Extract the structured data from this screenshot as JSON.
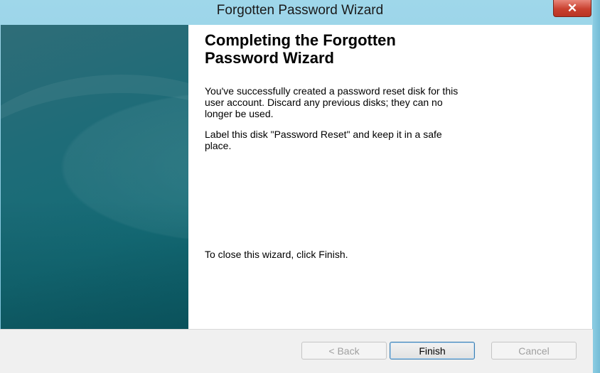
{
  "window": {
    "title": "Forgotten Password Wizard",
    "close_label": "✕"
  },
  "wizard": {
    "heading_line1": "Completing the Forgotten",
    "heading_line2": "Password Wizard",
    "para1_line1": "You've successfully created a password reset disk for this",
    "para1_line2": "user account. Discard any previous disks; they can no",
    "para1_line3": "longer be used.",
    "para2_line1": "Label this disk \"Password Reset\" and keep it in a safe",
    "para2_line2": "place.",
    "para3": "To close this wizard, click Finish."
  },
  "buttons": {
    "back": "< Back",
    "finish": "Finish",
    "cancel": "Cancel"
  },
  "colors": {
    "title_bar": "#9fd7ea",
    "side_panel": "#146b76",
    "close_button": "#c9412f"
  }
}
